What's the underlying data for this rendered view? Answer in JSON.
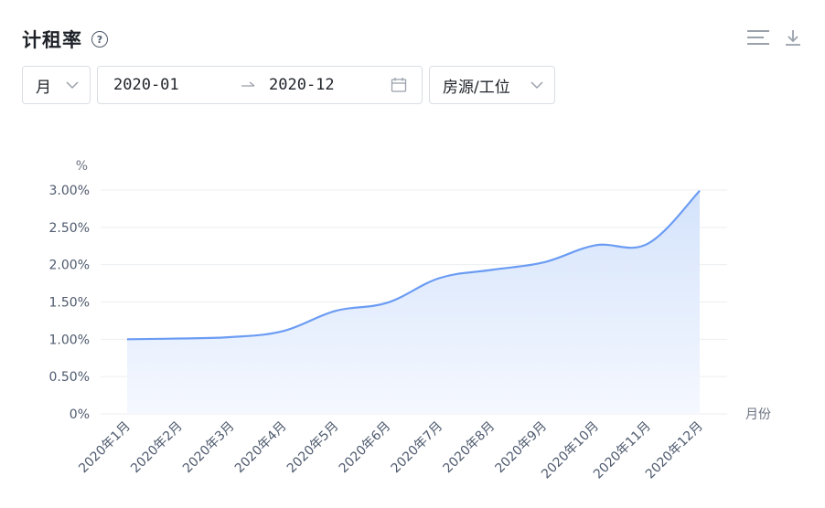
{
  "header": {
    "title": "计租率",
    "help_icon": "question-circle-icon"
  },
  "toolbar": {
    "list_icon": "list-lines-icon",
    "download_icon": "download-icon"
  },
  "filters": {
    "granularity": "月",
    "date_start": "2020-01",
    "date_end": "2020-12",
    "date_separator": "→",
    "category": "房源/工位"
  },
  "chart_data": {
    "type": "area",
    "title": "",
    "ylabel": "%",
    "xlabel": "月份",
    "categories": [
      "2020年1月",
      "2020年2月",
      "2020年3月",
      "2020年4月",
      "2020年5月",
      "2020年6月",
      "2020年7月",
      "2020年8月",
      "2020年9月",
      "2020年10月",
      "2020年11月",
      "2020年12月"
    ],
    "values": [
      1.0,
      1.01,
      1.03,
      1.11,
      1.38,
      1.49,
      1.82,
      1.93,
      2.03,
      2.26,
      2.28,
      2.99
    ],
    "ylim": [
      0,
      3
    ],
    "yticks": [
      "0%",
      "0.50%",
      "1.00%",
      "1.50%",
      "2.00%",
      "2.50%",
      "3.00%"
    ],
    "grid": true,
    "legend": "none",
    "line_color": "#6b9cf3",
    "fill_color": "#dbe7fc"
  }
}
